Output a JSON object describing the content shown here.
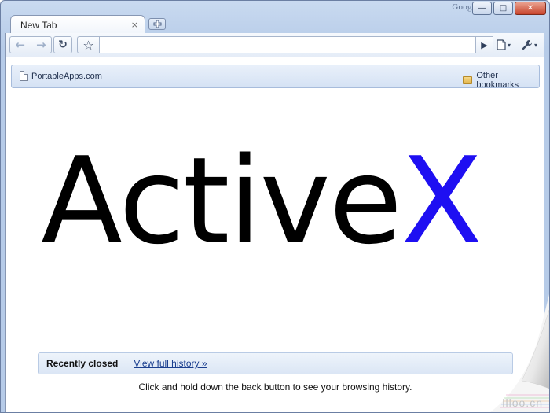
{
  "window": {
    "brand": "Google",
    "controls": {
      "minimize": "—",
      "maximize": "□",
      "close": "✕"
    }
  },
  "tabs": [
    {
      "label": "New Tab",
      "close": "×"
    }
  ],
  "toolbar": {
    "back_icon": "←",
    "forward_icon": "→",
    "reload_icon": "↻",
    "star_icon": "☆",
    "address_value": "",
    "go_icon": "▶",
    "page_menu_icon": "🗋",
    "tools_menu_icon": "🔧",
    "caret": "▾"
  },
  "bookmarks": {
    "items": [
      {
        "label": "PortableApps.com",
        "icon": "page-icon"
      }
    ],
    "other": {
      "label": "Other bookmarks",
      "icon": "folder-icon"
    }
  },
  "hero": {
    "text_main": "Active",
    "text_accent": "X",
    "color_main": "#000000",
    "color_accent": "#1e0ff2"
  },
  "recently_closed": {
    "title": "Recently closed",
    "link": "View full history »"
  },
  "hint": "Click and hold down the back button to see your browsing history.",
  "watermark": "llloo.cn",
  "colors": {
    "frame": "#b6cbe8",
    "bookmarks_bar": "#d5e2f4",
    "link": "#1b3f8f"
  }
}
